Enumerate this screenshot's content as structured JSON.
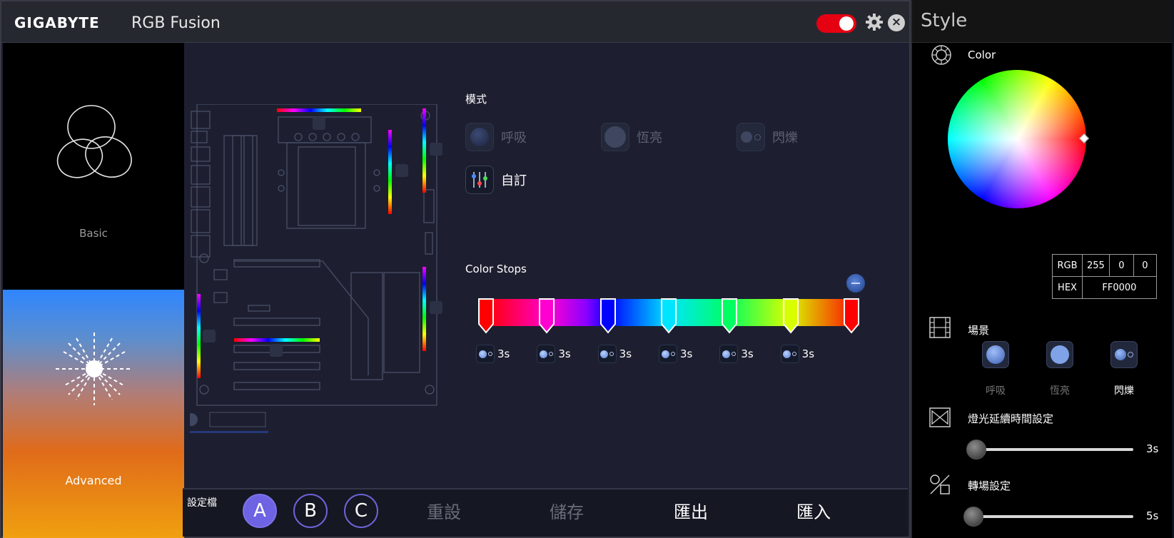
{
  "titlebar": {
    "brand": "GIGABYTE",
    "app_title": "RGB Fusion",
    "power_on": true,
    "accent_color": "#e50012"
  },
  "modes": {
    "basic_label": "Basic",
    "advanced_label": "Advanced"
  },
  "effect_mode": {
    "title": "模式",
    "options": [
      {
        "label": "呼吸",
        "icon": "breathing-icon",
        "active": false
      },
      {
        "label": "恆亮",
        "icon": "static-icon",
        "active": false
      },
      {
        "label": "閃爍",
        "icon": "flash-icon",
        "active": false
      },
      {
        "label": "自訂",
        "icon": "custom-sliders-icon",
        "active": true
      }
    ]
  },
  "color_stops": {
    "title": "Color Stops",
    "stops": [
      {
        "color": "#ff0000"
      },
      {
        "color": "#ff00d0"
      },
      {
        "color": "#0000ff"
      },
      {
        "color": "#00e5ff"
      },
      {
        "color": "#00ff60"
      },
      {
        "color": "#d8ff00"
      },
      {
        "color": "#ff0000"
      }
    ],
    "durations": [
      "3s",
      "3s",
      "3s",
      "3s",
      "3s",
      "3s"
    ]
  },
  "bottom_bar": {
    "profile_label": "設定檔",
    "profiles": [
      "A",
      "B",
      "C"
    ],
    "active_profile": "A",
    "reset": "重設",
    "save": "儲存",
    "export": "匯出",
    "import": "匯入"
  },
  "style_panel": {
    "title": "Style",
    "color_label": "Color",
    "rgb": {
      "label": "RGB",
      "r": "255",
      "g": "0",
      "b": "0"
    },
    "hex": {
      "label": "HEX",
      "value": "FF0000"
    },
    "scene": {
      "title": "場景",
      "options": [
        "呼吸",
        "恆亮",
        "閃爍"
      ],
      "active": "閃爍"
    },
    "duration": {
      "title": "燈光延續時間設定",
      "value": "3s",
      "level": 0.02
    },
    "transition": {
      "title": "轉場設定",
      "value": "5s",
      "level": 0.0
    }
  }
}
